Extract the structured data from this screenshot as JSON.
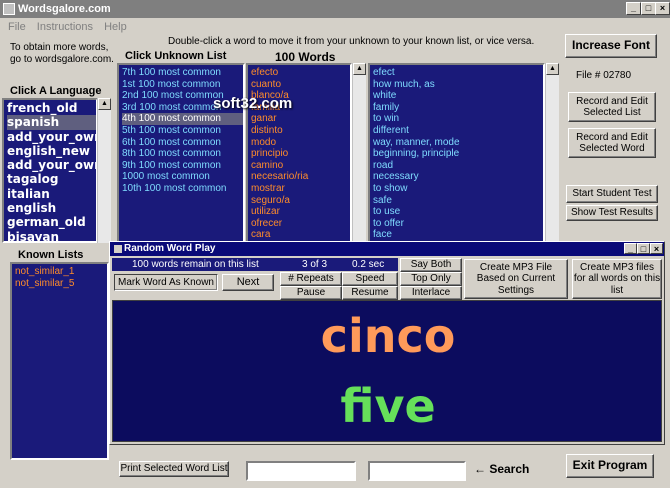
{
  "window": {
    "title": "Wordsgalore.com"
  },
  "menu": [
    "File",
    "Instructions",
    "Help"
  ],
  "info_text": "To obtain more words, go to wordsgalore.com.",
  "instruction": "Double-click a word to move it from your unknown to your known list, or vice versa.",
  "headings": {
    "unknown": "Click Unknown List",
    "words": "100 Words",
    "language": "Click A Language",
    "known": "Known Lists"
  },
  "unknown_lists": [
    "7th 100 most common",
    "1st 100 most common",
    "2nd 100 most common",
    "3rd 100 most common",
    "4th 100 most common",
    "5th 100 most common",
    "6th 100 most common",
    "8th 100 most common",
    "9th 100 most common",
    "1000 most common",
    "10th 100 most common"
  ],
  "unknown_selected": 4,
  "spanish_words": [
    "efecto",
    "cuanto",
    "blanco/a",
    "familia",
    "ganar",
    "distinto",
    "modo",
    "principio",
    "camino",
    "necesario/ria",
    "mostrar",
    "seguro/a",
    "utilizar",
    "ofrecer",
    "cara"
  ],
  "english_words": [
    "efect",
    "how much, as",
    "white",
    "family",
    "to win",
    "different",
    "way, manner, mode",
    "beginning, principle",
    "road",
    "necessary",
    "to show",
    "safe",
    "to use",
    "to offer",
    "face"
  ],
  "languages": [
    "french_old",
    "spanish",
    "add_your_own1",
    "english_new",
    "add_your_own2",
    "tagalog",
    "italian",
    "english",
    "german_old",
    "bisayan"
  ],
  "language_selected": 1,
  "known_lists": [
    "not_similar_1",
    "not_similar_5"
  ],
  "buttons": {
    "increase_font": "Increase Font",
    "record_list": "Record and Edit Selected List",
    "record_word": "Record and Edit Selected Word",
    "start_test": "Start Student Test",
    "show_results": "Show Test Results",
    "print_list": "Print Selected Word List",
    "exit": "Exit Program"
  },
  "file_no": "File # 02780",
  "search_label": "← Search",
  "popup": {
    "title": "Random Word Play",
    "remain": "100 words remain on this list",
    "count": "3 of 3",
    "time": "0.2 sec",
    "mark_known": "Mark Word As Known",
    "next": "Next",
    "repeats": "# Repeats",
    "speed": "Speed",
    "pause": "Pause",
    "resume": "Resume",
    "say_both": "Say Both",
    "top_only": "Top Only",
    "interlace": "Interlace",
    "mp3_current": "Create MP3 File Based on Current Settings",
    "mp3_all": "Create MP3 files for all words on this list",
    "word_top": "cinco",
    "word_bottom": "five"
  },
  "watermark": "soft32.com",
  "colors": {
    "panel_bg": "#1a1a7a",
    "spanish_text": "#ff8c2a",
    "english_text": "#ffffff",
    "cyan": "#7fdcff",
    "word_top": "#ff9a5a",
    "word_bottom": "#66e05a"
  }
}
